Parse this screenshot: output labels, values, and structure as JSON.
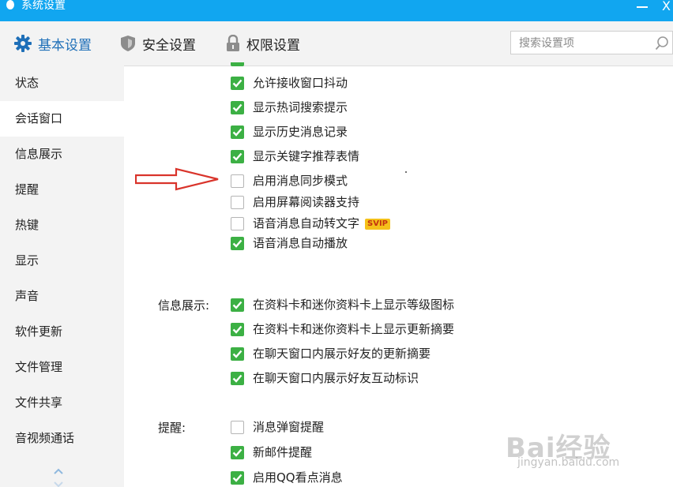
{
  "window": {
    "title": "系统设置",
    "close_glyph": "X"
  },
  "tabs": [
    {
      "label": "基本设置",
      "icon": "gear-icon",
      "active": true
    },
    {
      "label": "安全设置",
      "icon": "shield-icon",
      "active": false
    },
    {
      "label": "权限设置",
      "icon": "lock-icon",
      "active": false
    }
  ],
  "search": {
    "placeholder": "搜索设置项",
    "icon": "search-icon"
  },
  "sidebar": {
    "items": [
      {
        "label": "状态",
        "active": false
      },
      {
        "label": "会话窗口",
        "active": true
      },
      {
        "label": "信息展示",
        "active": false
      },
      {
        "label": "提醒",
        "active": false
      },
      {
        "label": "热键",
        "active": false
      },
      {
        "label": "显示",
        "active": false
      },
      {
        "label": "声音",
        "active": false
      },
      {
        "label": "软件更新",
        "active": false
      },
      {
        "label": "文件管理",
        "active": false
      },
      {
        "label": "文件共享",
        "active": false
      },
      {
        "label": "音视频通话",
        "active": false
      }
    ]
  },
  "sections": {
    "session": {
      "options": [
        {
          "label": "允许接收窗口抖动",
          "checked": true
        },
        {
          "label": "显示热词搜索提示",
          "checked": true
        },
        {
          "label": "显示历史消息记录",
          "checked": true
        },
        {
          "label": "显示关键字推荐表情",
          "checked": true
        },
        {
          "label": "启用消息同步模式",
          "checked": false
        },
        {
          "label": "启用屏幕阅读器支持",
          "checked": false
        },
        {
          "label": "语音消息自动转文字",
          "checked": false,
          "badge": "SVIP"
        },
        {
          "label": "语音消息自动播放",
          "checked": true
        }
      ]
    },
    "info": {
      "title": "信息展示:",
      "options": [
        {
          "label": "在资料卡和迷你资料卡上显示等级图标",
          "checked": true
        },
        {
          "label": "在资料卡和迷你资料卡上显示更新摘要",
          "checked": true
        },
        {
          "label": "在聊天窗口内展示好友的更新摘要",
          "checked": true
        },
        {
          "label": "在聊天窗口内展示好友互动标识",
          "checked": true
        }
      ]
    },
    "remind": {
      "title": "提醒:",
      "options": [
        {
          "label": "消息弹窗提醒",
          "checked": false
        },
        {
          "label": "新邮件提醒",
          "checked": true
        },
        {
          "label": "启用QQ看点消息",
          "checked": true
        }
      ]
    }
  },
  "watermark": {
    "logo": "Bai经验",
    "url": "jingyan.baidu.com"
  },
  "colors": {
    "accent": "#11a6f0",
    "check": "#3cb044",
    "annotation": "#d9342b"
  }
}
